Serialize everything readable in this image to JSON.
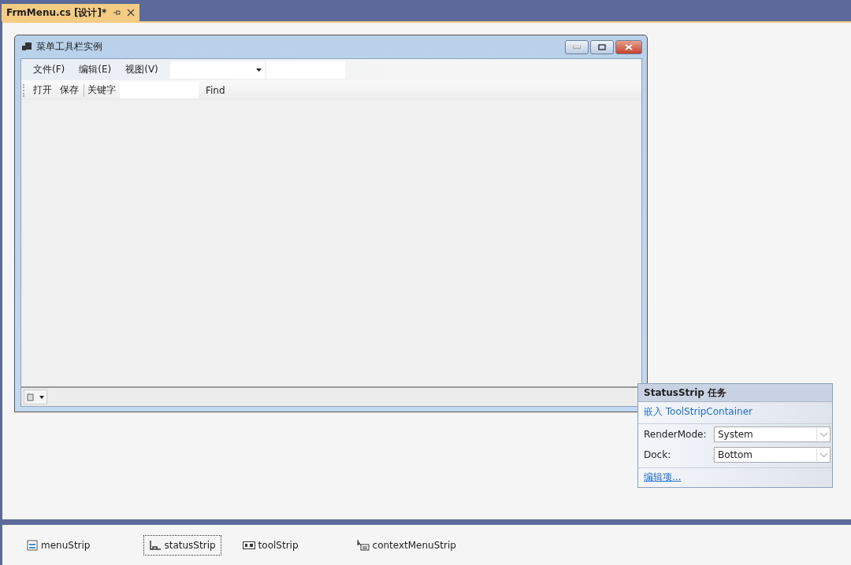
{
  "document_tab": {
    "title": "FrmMenu.cs [设计]*",
    "selected": true
  },
  "form": {
    "title": "菜单工具栏实例",
    "menu_items": [
      {
        "label": "文件(F)"
      },
      {
        "label": "编辑(E)"
      },
      {
        "label": "视图(V)"
      }
    ],
    "toolbar": [
      {
        "kind": "button",
        "label": "打开"
      },
      {
        "kind": "button",
        "label": "保存"
      },
      {
        "kind": "separator"
      },
      {
        "kind": "label",
        "label": "关键字"
      },
      {
        "kind": "textbox"
      },
      {
        "kind": "button",
        "label": "Find"
      }
    ]
  },
  "smart_tag": {
    "title": "StatusStrip 任务",
    "action_link": "嵌入 ToolStripContainer",
    "properties": [
      {
        "label": "RenderMode:",
        "value": "System"
      },
      {
        "label": "Dock:",
        "value": "Bottom"
      }
    ],
    "edit_link": "编辑项..."
  },
  "component_tray": [
    {
      "kind": "menu",
      "label": "menuStrip",
      "selected": false
    },
    {
      "kind": "status",
      "label": "statusStrip",
      "selected": true
    },
    {
      "kind": "tool",
      "label": "toolStrip",
      "selected": false
    },
    {
      "kind": "context",
      "label": "contextMenuStrip",
      "selected": false
    }
  ]
}
